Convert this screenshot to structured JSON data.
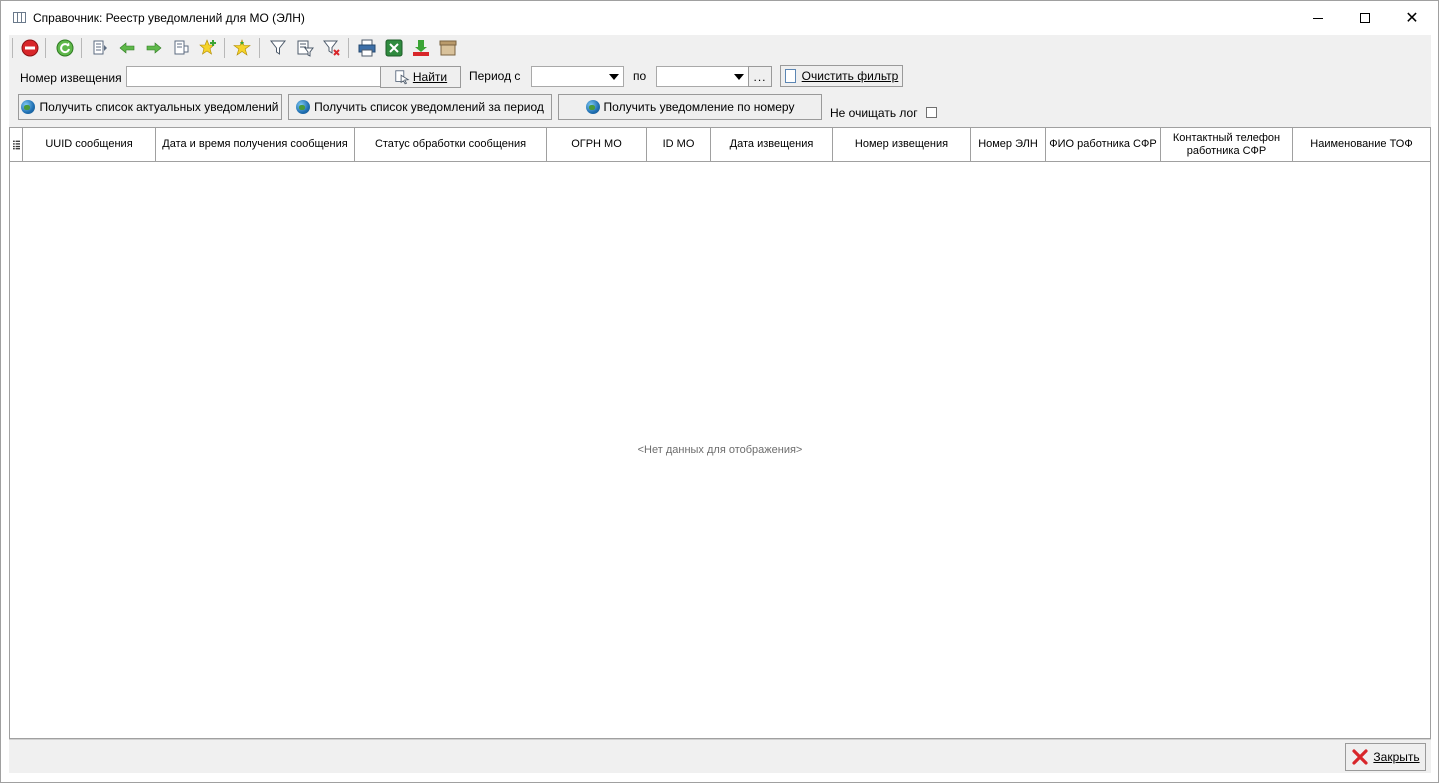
{
  "window": {
    "title": "Справочник: Реестр уведомлений для МО (ЭЛН)"
  },
  "toolbar": {
    "icons": [
      "stop-icon",
      "refresh-icon",
      "document-icon",
      "arrow-left-icon",
      "arrow-right-icon",
      "document-copy-icon",
      "add-star-icon",
      "favorite-star-icon",
      "filter-icon",
      "filter-edit-icon",
      "filter-clear-icon",
      "print-icon",
      "excel-icon",
      "export-icon",
      "archive-icon"
    ]
  },
  "filter": {
    "notice_number_label": "Номер извещения",
    "notice_number_value": "",
    "find_label": "Найти",
    "period_from_label": "Период с",
    "period_from_value": "",
    "period_to_label": "по",
    "period_to_value": "",
    "ellipsis_label": "...",
    "clear_filter_label": "Очистить фильтр",
    "get_actual_label": "Получить список актуальных уведомлений",
    "get_period_label": "Получить список уведомлений за период",
    "get_by_number_label": "Получить уведомление по номеру",
    "no_clear_log_label": "Не очищать лог",
    "no_clear_log_checked": false
  },
  "grid": {
    "columns": [
      "UUID сообщения",
      "Дата и время получения сообщения",
      "Статус обработки сообщения",
      "ОГРН МО",
      "ID МО",
      "Дата извещения",
      "Номер извещения",
      "Номер ЭЛН",
      "ФИО работника СФР",
      "Контактный телефон работника СФР",
      "Наименование ТОФ"
    ],
    "rows": [],
    "empty_text": "<Нет данных для отображения>"
  },
  "footer": {
    "close_label": "Закрыть"
  }
}
